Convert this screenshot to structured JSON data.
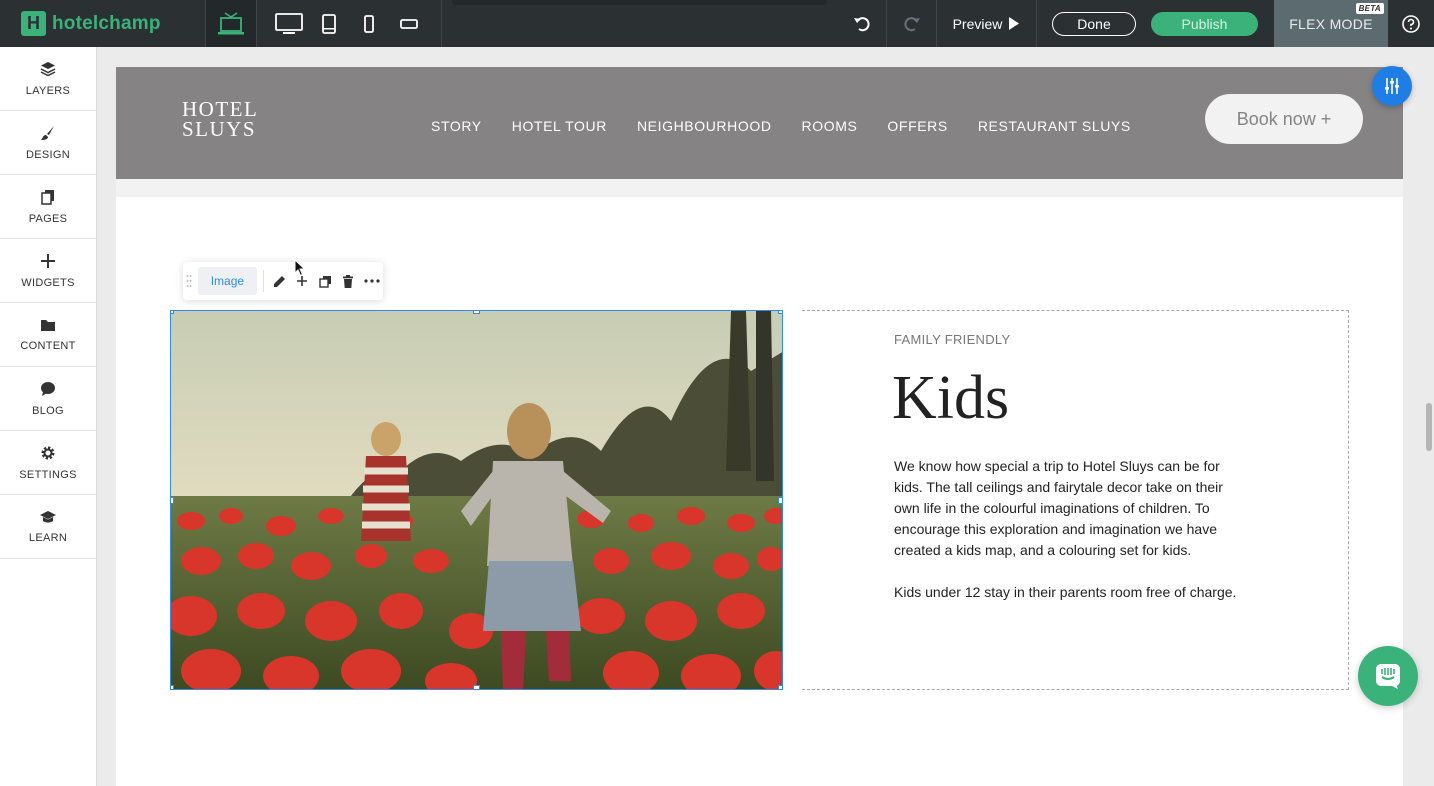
{
  "app": {
    "logo_text": "hotelchamp",
    "logo_mark": "H"
  },
  "topbar": {
    "preview_label": "Preview",
    "done_label": "Done",
    "publish_label": "Publish",
    "flex_mode_label": "FLEX MODE",
    "beta_badge": "BETA",
    "accent": "#3ab27a"
  },
  "sidebar": {
    "items": [
      {
        "label": "LAYERS",
        "icon": "layers-icon"
      },
      {
        "label": "DESIGN",
        "icon": "brush-icon"
      },
      {
        "label": "PAGES",
        "icon": "pages-icon"
      },
      {
        "label": "WIDGETS",
        "icon": "plus-icon"
      },
      {
        "label": "CONTENT",
        "icon": "folder-icon"
      },
      {
        "label": "BLOG",
        "icon": "chat-icon"
      },
      {
        "label": "SETTINGS",
        "icon": "gear-icon"
      },
      {
        "label": "LEARN",
        "icon": "graduation-cap-icon"
      }
    ]
  },
  "site": {
    "logo_line1": "HOTEL",
    "logo_line2": "SLUYS",
    "nav": [
      "STORY",
      "HOTEL TOUR",
      "NEIGHBOURHOOD",
      "ROOMS",
      "OFFERS",
      "RESTAURANT SLUYS"
    ],
    "book_label": "Book now +",
    "header_color": "#858384"
  },
  "element_toolbar": {
    "tag": "Image"
  },
  "section": {
    "eyebrow": "FAMILY FRIENDLY",
    "title": "Kids",
    "paragraph1": "We know how special a trip to Hotel Sluys can be for kids. The tall ceilings and fairytale decor take on their own life in the colourful imaginations of children. To encourage this exploration and imagination we have created a kids map, and a colouring set for kids.",
    "paragraph2": "Kids under 12 stay in their parents room free of charge."
  },
  "colors": {
    "selection": "#2f8be6",
    "float_tool": "#1f7ee6",
    "intercom": "#3ab27a"
  }
}
